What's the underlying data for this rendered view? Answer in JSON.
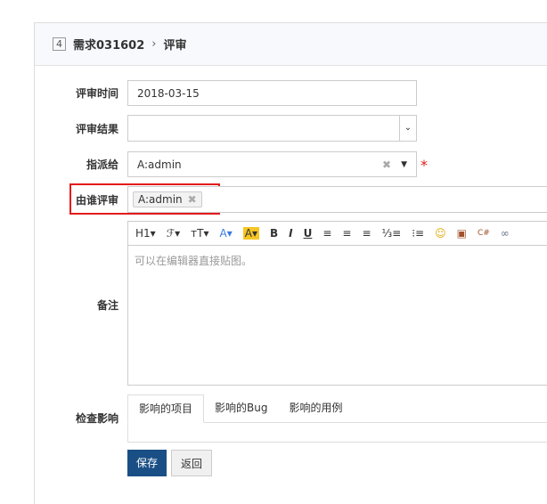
{
  "header": {
    "index": "4",
    "story": "需求031602",
    "separator": "›",
    "action": "评审"
  },
  "form": {
    "review_date": {
      "label": "评审时间",
      "value": "2018-03-15"
    },
    "review_result": {
      "label": "评审结果",
      "value": ""
    },
    "assigned_to": {
      "label": "指派给",
      "value": "A:admin",
      "required": "*"
    },
    "reviewed_by": {
      "label": "由谁评审",
      "chips": [
        "A:admin"
      ]
    },
    "comment": {
      "label": "备注",
      "placeholder": "可以在编辑器直接贴图。",
      "toolbar": [
        "H1▾",
        "ℱ▾",
        "ᴛT▾",
        "A▾",
        "A▾",
        "B",
        "I",
        "U",
        "≡",
        "≡",
        "≡",
        "⅓≡",
        "⁝≡",
        "☺",
        "▣",
        "C#",
        "∞"
      ]
    },
    "impact": {
      "label": "检查影响",
      "tabs": [
        "影响的项目",
        "影响的Bug",
        "影响的用例"
      ]
    }
  },
  "buttons": {
    "save": "保存",
    "back": "返回"
  },
  "colors": {
    "primary": "#1a4f85",
    "highlight": "#e31b1b"
  }
}
